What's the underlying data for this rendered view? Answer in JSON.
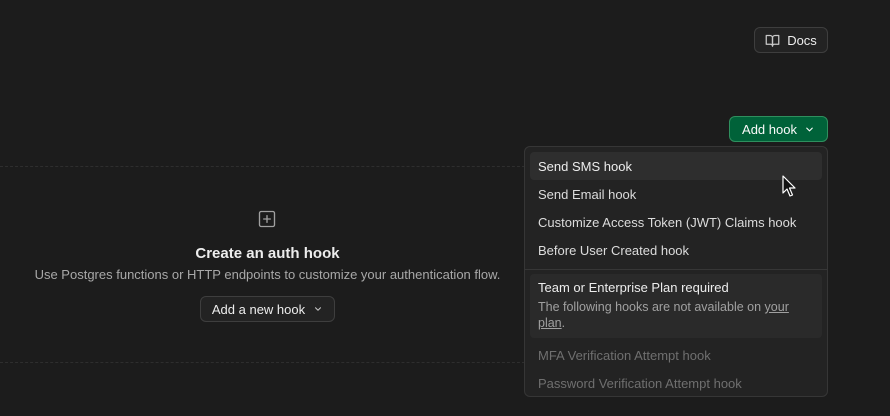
{
  "header": {
    "docs_label": "Docs",
    "docs_icon": "book-open-icon"
  },
  "toolbar": {
    "add_hook_label": "Add hook",
    "add_hook_icon": "chevron-down-icon",
    "accent": "#006239"
  },
  "empty_state": {
    "icon": "plus-square-icon",
    "title": "Create an auth hook",
    "description": "Use Postgres functions or HTTP endpoints to customize your authentication flow.",
    "button_label": "Add a new hook"
  },
  "menu": {
    "items": [
      {
        "label": "Send SMS hook"
      },
      {
        "label": "Send Email hook"
      },
      {
        "label": "Customize Access Token (JWT) Claims hook"
      },
      {
        "label": "Before User Created hook"
      }
    ],
    "plan_notice": {
      "title": "Team or Enterprise Plan required",
      "desc_prefix": "The following hooks are not available on ",
      "link_part1": "your",
      "link_part2": "plan",
      "desc_suffix": "."
    },
    "disabled_items": [
      {
        "label": "MFA Verification Attempt hook"
      },
      {
        "label": "Password Verification Attempt hook"
      }
    ]
  }
}
